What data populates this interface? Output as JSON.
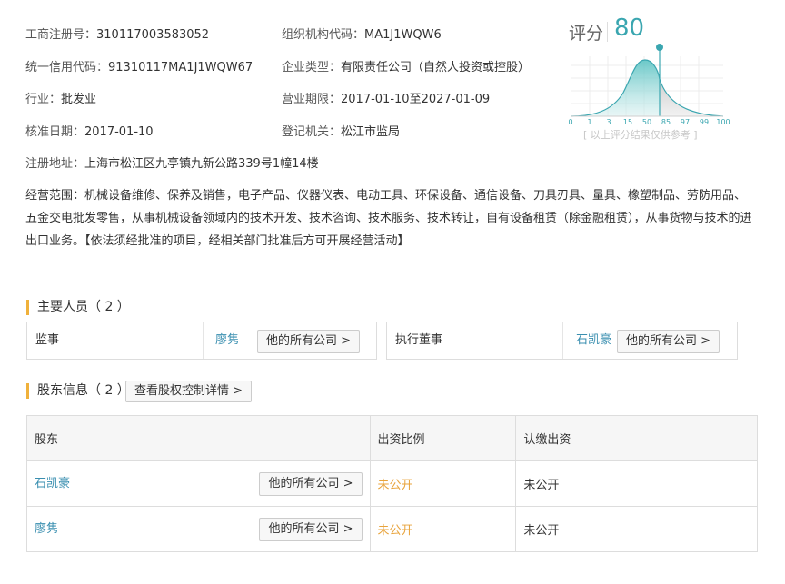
{
  "info": {
    "reg_no": {
      "label": "工商注册号：",
      "value": "310117003583052"
    },
    "org_code": {
      "label": "组织机构代码：",
      "value": "MA1J1WQW6"
    },
    "credit_code": {
      "label": "统一信用代码：",
      "value": "91310117MA1J1WQW67"
    },
    "company_type": {
      "label": "企业类型：",
      "value": "有限责任公司（自然人投资或控股）"
    },
    "industry": {
      "label": "行业：",
      "value": "批发业"
    },
    "term": {
      "label": "营业期限：",
      "value": "2017-01-10至2027-01-09"
    },
    "approval_date": {
      "label": "核准日期：",
      "value": "2017-01-10"
    },
    "authority": {
      "label": "登记机关：",
      "value": "松江市监局"
    },
    "address": {
      "label": "注册地址：",
      "value": "上海市松江区九亭镇九新公路339号1幢14楼"
    },
    "scope": {
      "label": "经营范围：",
      "value": "机械设备维修、保养及销售，电子产品、仪器仪表、电动工具、环保设备、通信设备、刀具刃具、量具、橡塑制品、劳防用品、五金交电批发零售，从事机械设备领域内的技术开发、技术咨询、技术服务、技术转让，自有设备租赁（除金融租赁），从事货物与技术的进出口业务。【依法须经批准的项目，经相关部门批准后方可开展经营活动】"
    }
  },
  "score": {
    "title": "评分",
    "value": "80",
    "axis_ticks": [
      "0",
      "1",
      "3",
      "15",
      "50",
      "85",
      "97",
      "99",
      "100"
    ],
    "note": "[ 以上评分结果仅供参考 ]",
    "accent": "#3aa6b0"
  },
  "staff": {
    "title": "主要人员",
    "count": "（ 2 ）",
    "members": [
      {
        "role": "监事",
        "name": "廖隽",
        "button": "他的所有公司 >"
      },
      {
        "role": "执行董事",
        "name": "石凯豪",
        "button": "他的所有公司 >"
      }
    ]
  },
  "shareholders": {
    "title": "股东信息",
    "count": "（ 2 ）",
    "detail_button": "查看股权控制详情 >",
    "columns": [
      "股东",
      "出资比例",
      "认缴出资"
    ],
    "rows": [
      {
        "name": "石凯豪",
        "button": "他的所有公司 >",
        "ratio": "未公开",
        "amount": "未公开"
      },
      {
        "name": "廖隽",
        "button": "他的所有公司 >",
        "ratio": "未公开",
        "amount": "未公开"
      }
    ]
  }
}
